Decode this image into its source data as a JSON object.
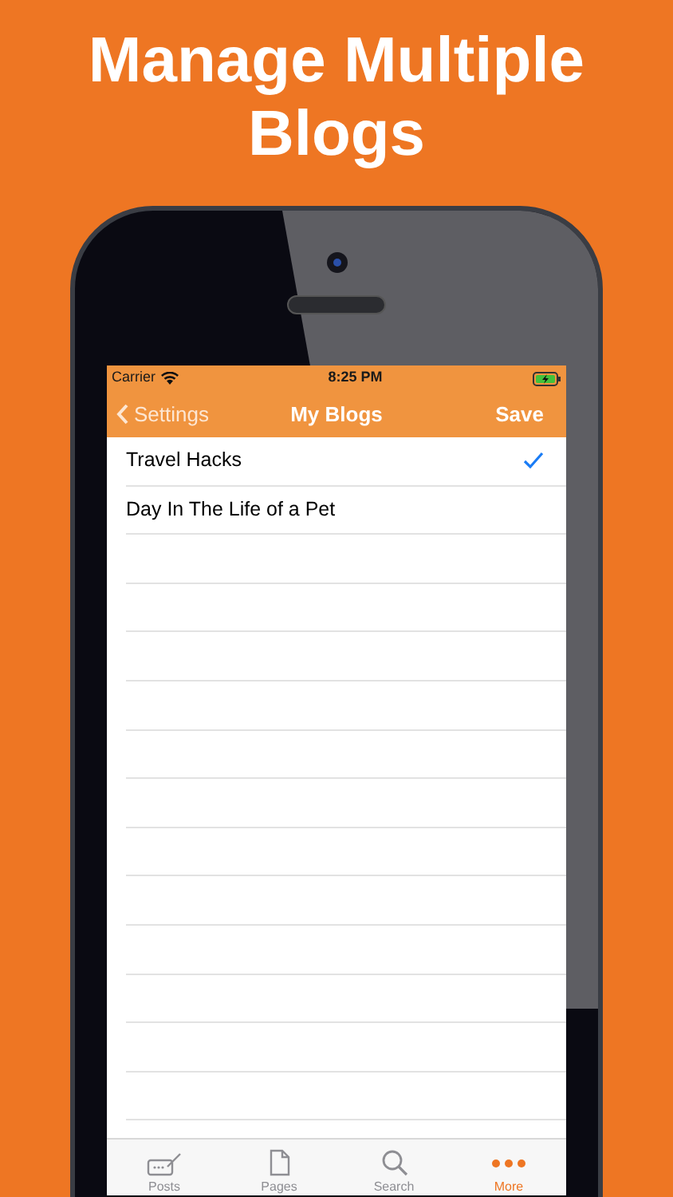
{
  "headline": "Manage Multiple Blogs",
  "status_bar": {
    "carrier": "Carrier",
    "time": "8:25 PM"
  },
  "nav_bar": {
    "back": "Settings",
    "title": "My Blogs",
    "action": "Save"
  },
  "blogs": [
    {
      "name": "Travel Hacks",
      "selected": true
    },
    {
      "name": "Day In The Life of a Pet",
      "selected": false
    }
  ],
  "tab_bar": [
    {
      "label": "Posts",
      "kind": "posts",
      "selected": false
    },
    {
      "label": "Pages",
      "kind": "pages",
      "selected": false
    },
    {
      "label": "Search",
      "kind": "search",
      "selected": false
    },
    {
      "label": "More",
      "kind": "more",
      "selected": true
    }
  ]
}
